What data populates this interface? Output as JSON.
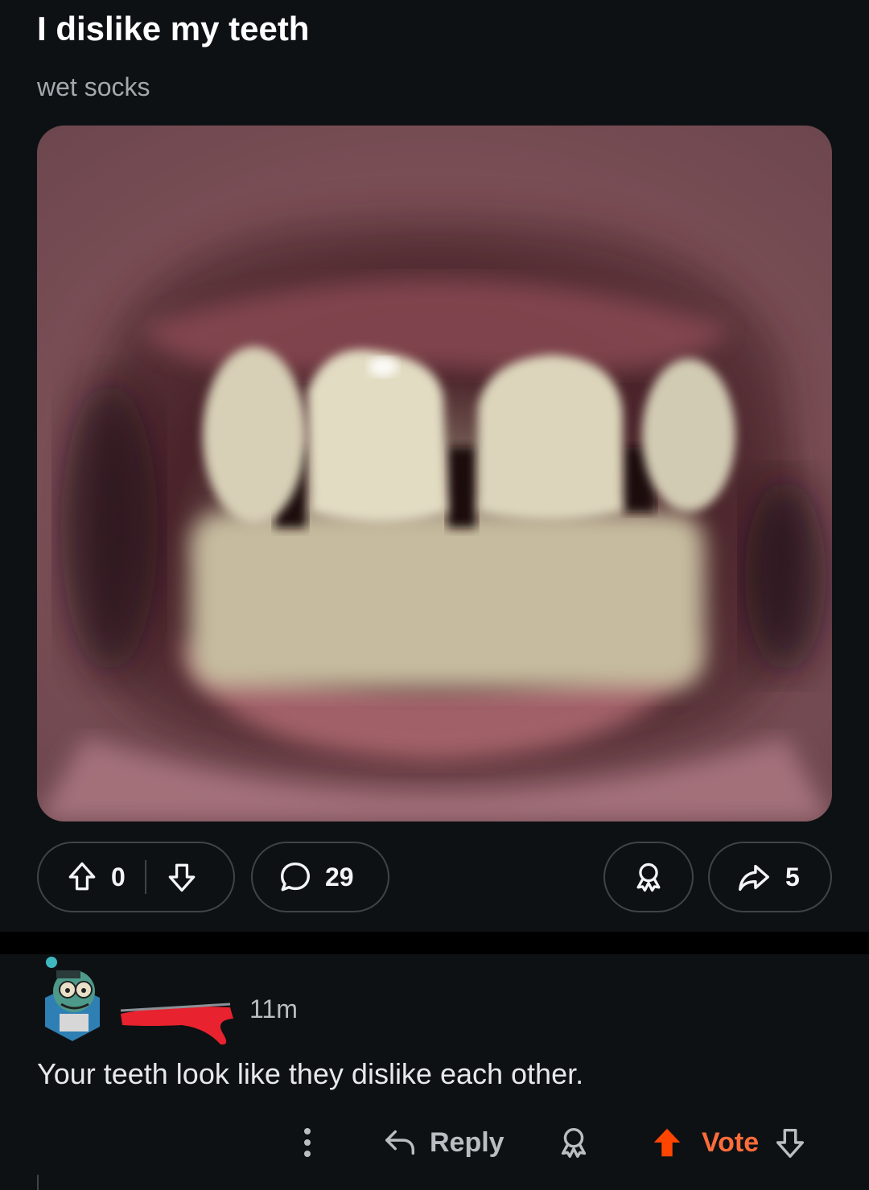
{
  "post": {
    "title": "I dislike my teeth",
    "body": "wet socks",
    "image_alt": "Close-up photo of teeth",
    "upvotes": "0",
    "comments": "29",
    "shares": "5"
  },
  "comment": {
    "username": "",
    "time": "11m",
    "text": "Your teeth look like they dislike each other.",
    "reply_label": "Reply",
    "vote_label": "Vote"
  },
  "colors": {
    "background": "#0e1113",
    "border": "#3e4448",
    "vote_accent": "#ff6c3b",
    "redaction": "#e8222e"
  }
}
